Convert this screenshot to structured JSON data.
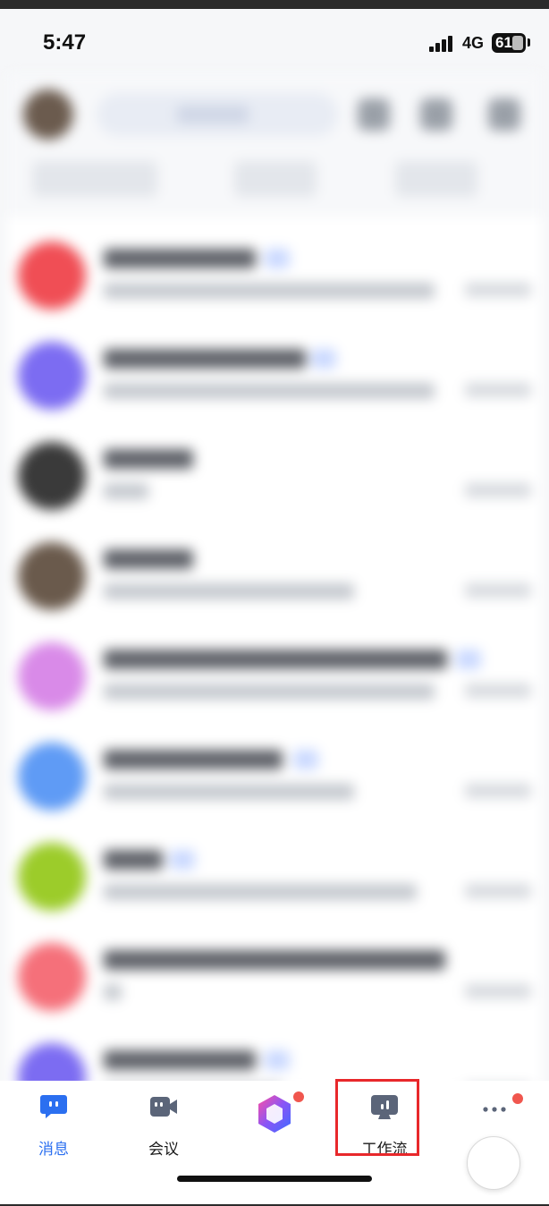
{
  "status_bar": {
    "time": "5:47",
    "network": "4G",
    "battery": "61"
  },
  "tabs": [
    {
      "label": "消息",
      "icon": "message-icon",
      "active": true
    },
    {
      "label": "会议",
      "icon": "video-camera-icon",
      "active": false
    },
    {
      "label": "",
      "icon": "ai-assistant-logo-icon",
      "active": false,
      "badge": true
    },
    {
      "label": "工作流",
      "icon": "workflow-icon",
      "active": false,
      "highlighted": true
    },
    {
      "label": "更多",
      "icon": "more-dots-icon",
      "active": false,
      "badge": true
    }
  ],
  "colors": {
    "active": "#2b6ff0",
    "inactive": "#1a1a1a",
    "badge": "#f0564e",
    "highlight": "#e8282b"
  }
}
